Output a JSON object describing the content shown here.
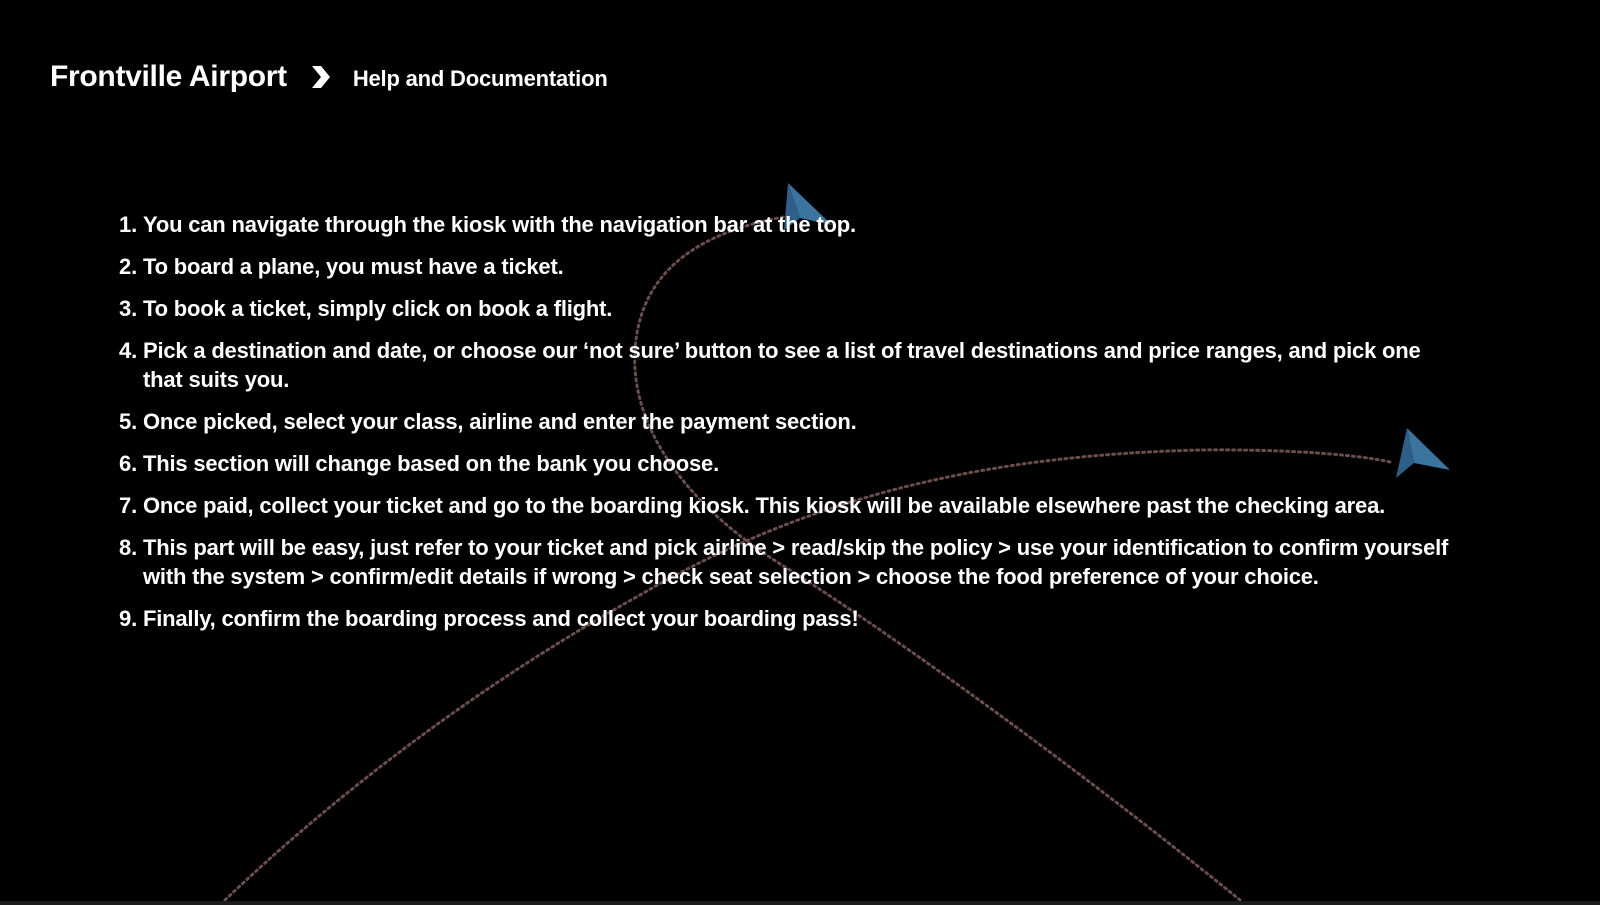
{
  "header": {
    "app_title": "Frontville Airport",
    "separator_icon": "chevron-right-icon",
    "page_title": "Help and Documentation"
  },
  "instructions": [
    {
      "number": "1.",
      "text": "You can navigate through the kiosk with the navigation bar at the top."
    },
    {
      "number": "2.",
      "text": "To board a plane, you must have a ticket."
    },
    {
      "number": "3.",
      "text": "To book a ticket, simply click on book a flight."
    },
    {
      "number": "4.",
      "text": "Pick a destination and date, or choose our ‘not sure’ button to see a list of travel destinations and price ranges, and pick one that suits you."
    },
    {
      "number": "5.",
      "text": "Once picked, select your class, airline and enter the payment section."
    },
    {
      "number": "6.",
      "text": "This section will change based on the bank you choose."
    },
    {
      "number": "7.",
      "text": "Once paid, collect your ticket and go to the boarding kiosk. This kiosk will be available elsewhere past the checking area."
    },
    {
      "number": "8.",
      "text": "This part will be easy, just refer to your ticket and pick airline > read/skip the policy > use your identification to confirm yourself with the system > confirm/edit details if wrong > check seat selection > choose the food preference of your choice."
    },
    {
      "number": "9.",
      "text": "Finally, confirm the boarding process and collect your boarding pass!"
    }
  ],
  "background": {
    "icons": [
      "paper-plane-icon",
      "paper-plane-icon"
    ],
    "colors": {
      "page_background": "#000000",
      "text": "#ffffff",
      "plane": "#3d7aa8",
      "flight_path": "#6b4d4a"
    }
  }
}
